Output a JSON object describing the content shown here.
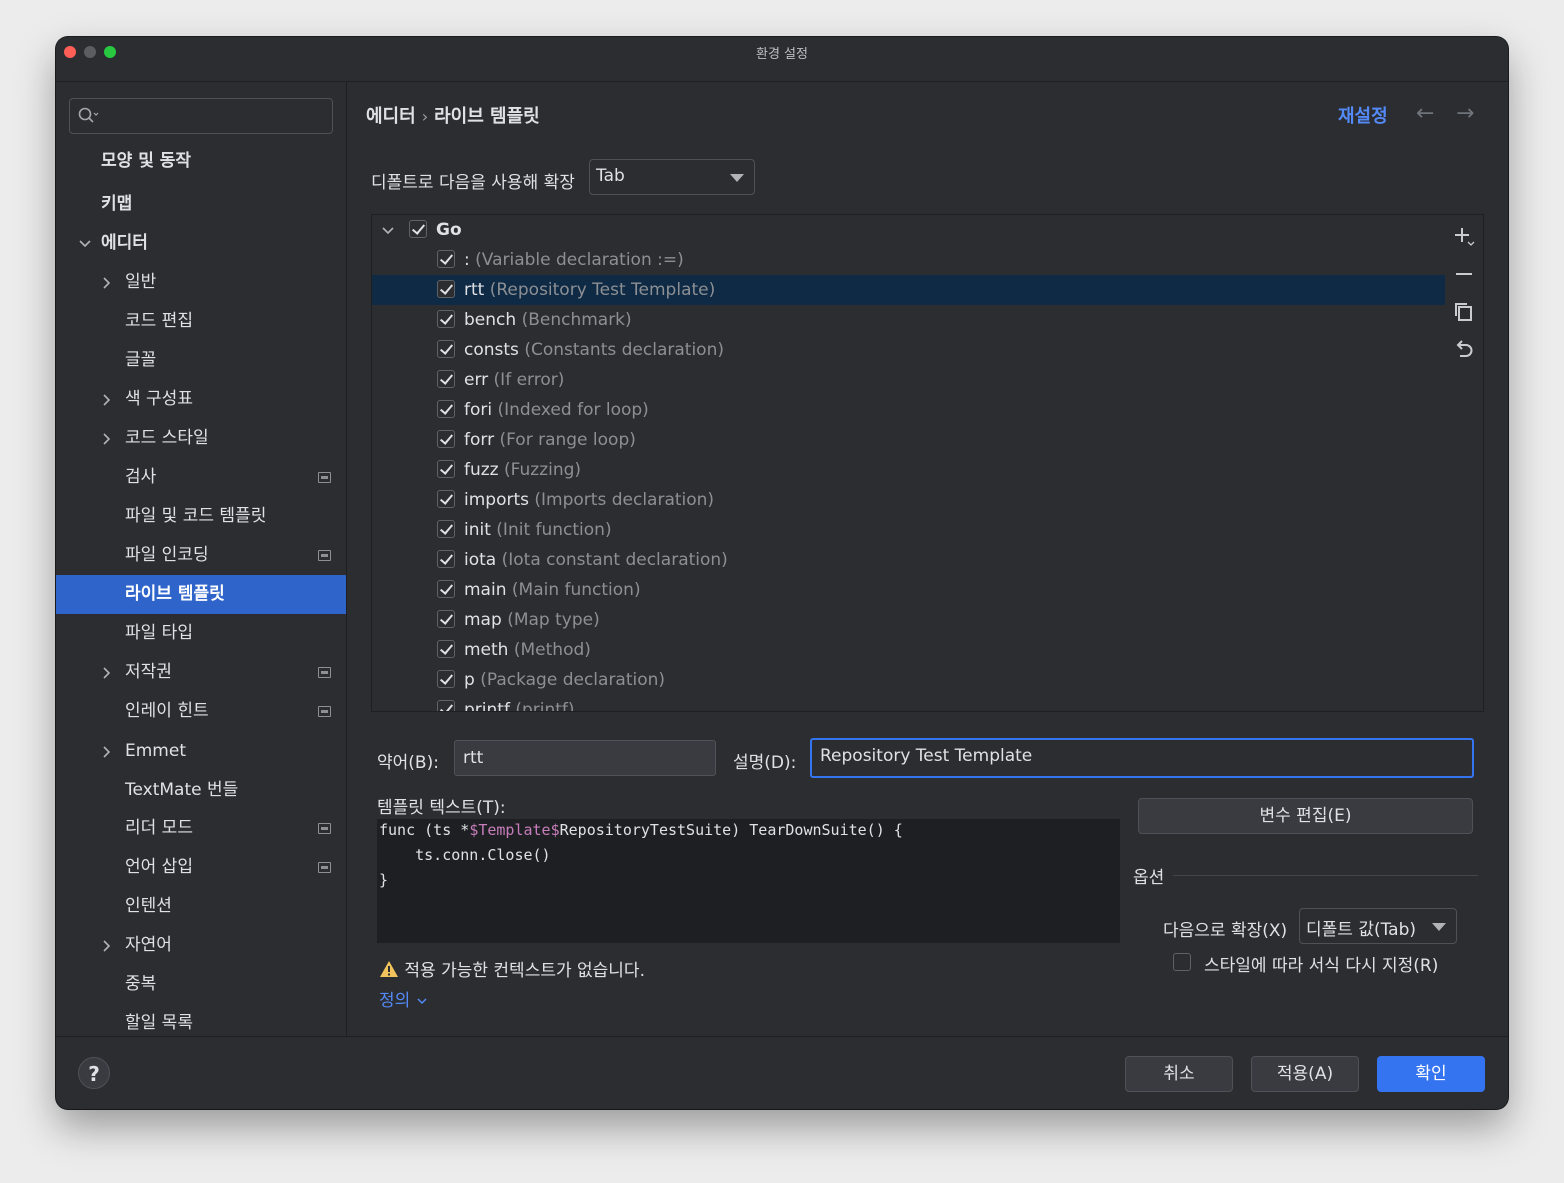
{
  "window": {
    "title": "환경 설정"
  },
  "sidebar": {
    "search_placeholder": "",
    "items": [
      {
        "label": "모양 및 동작",
        "bold": true
      },
      {
        "label": "키맵",
        "bold": true
      },
      {
        "label": "에디터",
        "bold": true,
        "expanded": true
      },
      {
        "label": "일반"
      },
      {
        "label": "코드 편집"
      },
      {
        "label": "글꼴"
      },
      {
        "label": "색 구성표"
      },
      {
        "label": "코드 스타일"
      },
      {
        "label": "검사"
      },
      {
        "label": "파일 및 코드 템플릿"
      },
      {
        "label": "파일 인코딩"
      },
      {
        "label": "라이브 템플릿",
        "selected": true
      },
      {
        "label": "파일 타입"
      },
      {
        "label": "저작권"
      },
      {
        "label": "인레이 힌트"
      },
      {
        "label": "Emmet"
      },
      {
        "label": "TextMate 번들"
      },
      {
        "label": "리더 모드"
      },
      {
        "label": "언어 삽입"
      },
      {
        "label": "인텐션"
      },
      {
        "label": "자연어"
      },
      {
        "label": "중복"
      },
      {
        "label": "할일 목록"
      }
    ]
  },
  "header": {
    "breadcrumb": [
      "에디터",
      "라이브 템플릿"
    ],
    "breadcrumb_sep": "›",
    "reset_label": "재설정",
    "back_arrow": "←",
    "forward_arrow": "→"
  },
  "expand_with": {
    "label": "디폴트로 다음을 사용해 확장",
    "value": "Tab"
  },
  "templates": {
    "group": {
      "name": "Go",
      "checked": true
    },
    "items": [
      {
        "abbr": ":",
        "desc": "(Variable declaration :=)"
      },
      {
        "abbr": "rtt",
        "desc": "(Repository Test Template)",
        "selected": true
      },
      {
        "abbr": "bench",
        "desc": "(Benchmark)"
      },
      {
        "abbr": "consts",
        "desc": "(Constants declaration)"
      },
      {
        "abbr": "err",
        "desc": "(If error)"
      },
      {
        "abbr": "fori",
        "desc": "(Indexed for loop)"
      },
      {
        "abbr": "forr",
        "desc": "(For range loop)"
      },
      {
        "abbr": "fuzz",
        "desc": "(Fuzzing)"
      },
      {
        "abbr": "imports",
        "desc": "(Imports declaration)"
      },
      {
        "abbr": "init",
        "desc": "(Init function)"
      },
      {
        "abbr": "iota",
        "desc": "(Iota constant declaration)"
      },
      {
        "abbr": "main",
        "desc": "(Main function)"
      },
      {
        "abbr": "map",
        "desc": "(Map type)"
      },
      {
        "abbr": "meth",
        "desc": "(Method)"
      },
      {
        "abbr": "p",
        "desc": "(Package declaration)"
      },
      {
        "abbr": "printf",
        "desc": "(printf)"
      }
    ],
    "tools": [
      "plus-icon",
      "minus-icon",
      "copy-icon",
      "undo-icon"
    ]
  },
  "abbreviation": {
    "label": "약어(B):",
    "value": "rtt"
  },
  "description": {
    "label": "설명(D):",
    "value": "Repository Test Template"
  },
  "template_text": {
    "label": "템플릿 텍스트(T):",
    "line1_pre": "func (ts *",
    "line1_var": "$Template$",
    "line1_post": "RepositoryTestSuite) TearDownSuite() {",
    "line2": "    ts.conn.Close()",
    "line3": "}"
  },
  "edit_variables_label": "변수 편집(E)",
  "options": {
    "title": "옵션",
    "expand_label": "다음으로 확장(X)",
    "expand_value": "디폴트 값(Tab)",
    "reformat_label": "스타일에 따라 서식 다시 지정(R)",
    "reformat_checked": false
  },
  "warning": {
    "text": "적용 가능한 컨텍스트가 없습니다.",
    "define_label": "정의"
  },
  "footer": {
    "help": "?",
    "cancel": "취소",
    "apply": "적용(A)",
    "ok": "확인"
  },
  "colors": {
    "accent": "#3574f0",
    "selection": "#2f65ca",
    "link": "#548af7",
    "variable": "#c77dbb",
    "warning": "#f2c55c"
  }
}
